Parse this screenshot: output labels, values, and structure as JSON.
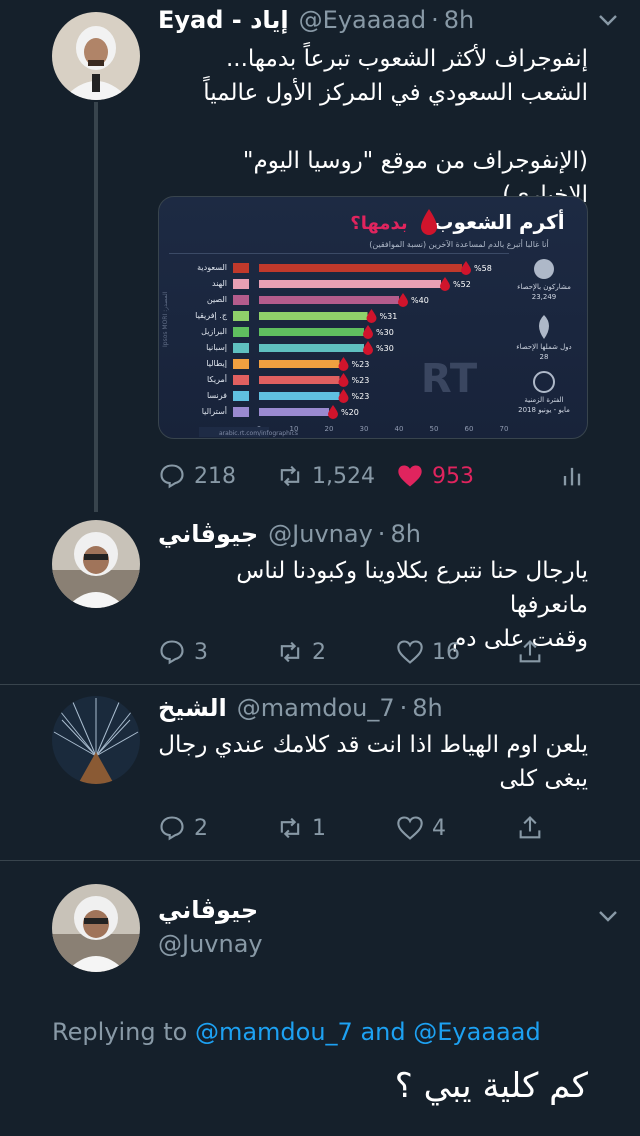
{
  "tweets": [
    {
      "name": "Eyad - إياد",
      "handle": "@Eyaaaad",
      "time": "8h",
      "text": "إنفوجراف لأكثر الشعوب تبرعاً بدمها...\nالشعب السعودي في المركز الأول عالمياً\n\n(الإنفوجراف من موقع \"روسيا اليوم\" الإخباري)",
      "replies": "218",
      "retweets": "1,524",
      "likes": "953"
    },
    {
      "name": "جيوڤاني",
      "handle": "@Juvnay",
      "time": "8h",
      "text": "يارجال حنا نتبرع بكلاوينا وكبودنا لناس مانعرفها\nوقفت على دم",
      "replies": "3",
      "retweets": "2",
      "likes": "16"
    },
    {
      "name": "الشيخ",
      "handle": "@mamdou_7",
      "time": "8h",
      "text": "يلعن اوم الهياط اذا انت قد كلامك عندي رجال\nيبغى كلى",
      "replies": "2",
      "retweets": "1",
      "likes": "4"
    }
  ],
  "focused": {
    "name": "جيوڤاني",
    "handle": "@Juvnay",
    "replying_prefix": "Replying to",
    "mention1": "@mamdou_7",
    "and": "and",
    "mention2": "@Eyaaaad",
    "text": "كم كلية يبي ؟"
  },
  "infographic": {
    "title": "أكرم الشعوب",
    "title_suffix": "بدمها؟",
    "subtitle": "أنا غالبا أتبرع بالدم لمساعدة الآخرين (نسبة الموافقين)",
    "side_stats": [
      {
        "label": "مشاركون بالإحصاء",
        "value": "23,249"
      },
      {
        "label": "دول شملها الإحصاء",
        "value": "28"
      },
      {
        "label": "الفترة الزمنية",
        "value": "مايو - يونيو 2018"
      }
    ],
    "watermark": "RT",
    "footer_url": "arabic.rt.com/infographics",
    "source": "Ipsos MORI :المصدر"
  },
  "chart_data": {
    "type": "bar",
    "orientation": "horizontal",
    "categories": [
      "السعودية",
      "الهند",
      "الصين",
      "ج. إفريقيا",
      "البرازيل",
      "إسبانيا",
      "إيطاليا",
      "أمريكا",
      "فرنسا",
      "أستراليا"
    ],
    "values": [
      58,
      52,
      40,
      31,
      30,
      30,
      23,
      23,
      23,
      20
    ],
    "value_labels": [
      "%58",
      "%52",
      "%40",
      "%31",
      "%30",
      "%30",
      "%23",
      "%23",
      "%23",
      "%20"
    ],
    "xlim": [
      0,
      70
    ],
    "xticks": [
      "0",
      "10",
      "20",
      "30",
      "40",
      "50",
      "60",
      "70"
    ],
    "colors": [
      "#c0392b",
      "#e8a0b4",
      "#b45c8c",
      "#8fd16a",
      "#5fbf5f",
      "#5fc0c0",
      "#f0a040",
      "#e06060",
      "#60c0e0",
      "#9a8ad0"
    ]
  },
  "colors": {
    "background": "#15202b",
    "secondary_text": "#8899a6",
    "link": "#1da1f2",
    "like": "#e0245e",
    "line": "#38444d"
  }
}
